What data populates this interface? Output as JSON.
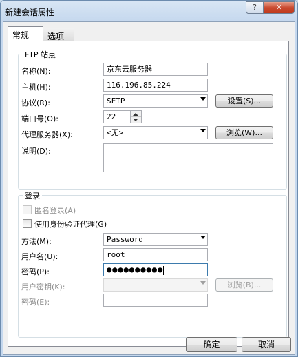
{
  "window": {
    "title": "新建会话属性",
    "help_label": "?",
    "close_label": "✕"
  },
  "tabs": [
    {
      "label": "常规"
    },
    {
      "label": "选项"
    }
  ],
  "ftp": {
    "group_title": "FTP 站点",
    "name_label": "名称(N):",
    "name_value": "京东云服务器",
    "host_label": "主机(H):",
    "host_value": "116.196.85.224",
    "protocol_label": "协议(R):",
    "protocol_value": "SFTP",
    "settings_button": "设置(S)...",
    "port_label": "端口号(O):",
    "port_value": "22",
    "proxy_label": "代理服务器(X):",
    "proxy_value": "<无>",
    "browse_button": "浏览(W)...",
    "desc_label": "说明(D):",
    "desc_value": ""
  },
  "login": {
    "group_title": "登录",
    "anonymous_label": "匿名登录(A)",
    "anonymous_checked": false,
    "agent_label": "使用身份验证代理(G)",
    "agent_checked": false,
    "method_label": "方法(M):",
    "method_value": "Password",
    "username_label": "用户名(U):",
    "username_value": "root",
    "password_label": "密码(P):",
    "password_value": "●●●●●●●●●●",
    "userkey_label": "用户密钥(K):",
    "userkey_value": "",
    "browse_button": "浏览(B)...",
    "passphrase_label": "密码(E):",
    "passphrase_value": ""
  },
  "footer": {
    "ok_button": "确定",
    "cancel_button": "取消"
  }
}
